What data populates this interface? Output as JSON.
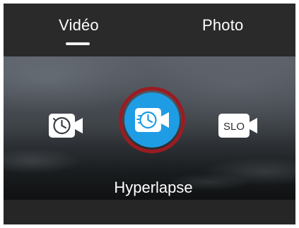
{
  "tabs": [
    {
      "label": "Vidéo",
      "selected": true
    },
    {
      "label": "Photo",
      "selected": false
    }
  ],
  "modes": [
    {
      "icon": "timelapse-camera-icon",
      "label": ""
    },
    {
      "icon": "hyperlapse-camera-icon",
      "label": "Hyperlapse",
      "selected": true
    },
    {
      "icon": "slo-mo-camera-icon",
      "badge": "SLO",
      "label": ""
    }
  ],
  "current_mode_label": "Hyperlapse",
  "colors": {
    "accent": "#1e9de5",
    "highlight_ring": "#9a1c22"
  }
}
